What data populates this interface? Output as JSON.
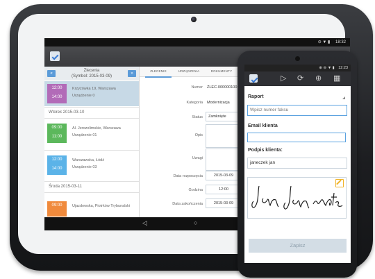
{
  "tablet": {
    "status_bar": {
      "icons": "⊖ ▼ ▮",
      "time": "18:32"
    },
    "list_panel": {
      "title": "Zlecenia",
      "subtitle": "(Symbol: 2015-03-09)",
      "prev_icon": "double-chevron-left-icon",
      "next_icon": "double-chevron-right-icon",
      "days": [
        {
          "label": "",
          "items": [
            {
              "start": "12:00",
              "end": "14:00",
              "line1": "Krzyżówka 19, Warszawa",
              "line2": "Urządzenie 0",
              "color": "#b26bb8",
              "selected": true
            }
          ]
        },
        {
          "label": "Wtorek 2015-03-10",
          "items": [
            {
              "start": "09:00",
              "end": "11:00",
              "line1": "Al. Jerozolimskie, Warszawa",
              "line2": "Urządzenie 01",
              "color": "#5cb85c",
              "selected": false
            },
            {
              "start": "12:00",
              "end": "14:00",
              "line1": "Warszawska, Łódź",
              "line2": "Urządzenie 03",
              "color": "#5bb3e8",
              "selected": false
            }
          ]
        },
        {
          "label": "Środa 2015-03-11",
          "items": [
            {
              "start": "09:00",
              "end": "",
              "line1": "Ujazdowska, Piotrków Trybunalski",
              "line2": "",
              "color": "#f08a3c",
              "selected": false
            }
          ]
        }
      ]
    },
    "tabs": [
      "ZLECENIE",
      "URZĄDZENIA",
      "DOKUMENTY"
    ],
    "form": {
      "numer_label": "Numer",
      "numer_value": "ZLEC-000000100",
      "kategoria_label": "Kategoria",
      "kategoria_value": "Modernizacja",
      "status_label": "Status",
      "status_value": "Zamknięte",
      "opis_label": "Opis",
      "uwagi_label": "Uwagi",
      "data_rozp_label": "Data rozpoczęcia",
      "data_rozp_value": "2015-03-09",
      "godzina_label": "Godzina",
      "godzina_value": "12:00",
      "data_zak_label": "Data zakończenia",
      "data_zak_value": "2015-03-09"
    },
    "nav": {
      "back": "◁",
      "home": "○"
    }
  },
  "phone": {
    "status_bar": {
      "icons": "⊕ ⊖ ▼ ▮",
      "time": "12:23"
    },
    "toolbar_icons": [
      "play-icon",
      "sync-icon",
      "globe-icon",
      "calendar-icon"
    ],
    "raport_label": "Raport",
    "fax_placeholder": "Wpisz numer faksu",
    "email_label": "Email klienta",
    "email_value": "",
    "signature_label": "Podpis klienta:",
    "signer_name": "janeczek jan",
    "save_label": "Zapisz"
  },
  "colors": {
    "accent": "#5b9bd8",
    "input_border": "#5aa2e0",
    "edit_icon": "#f0b429"
  }
}
